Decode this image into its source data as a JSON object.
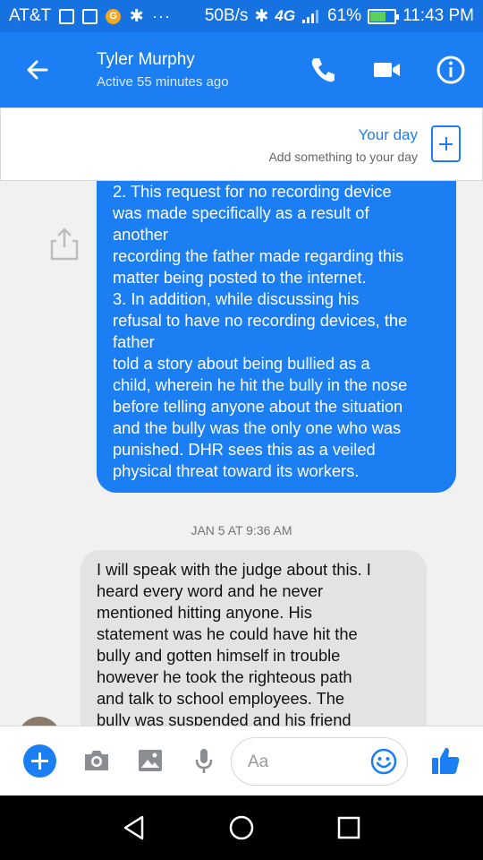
{
  "statusbar": {
    "carrier": "AT&T",
    "overflow": "···",
    "speed": "50B/s",
    "network": "4G",
    "battery": "61%",
    "time": "11:43 PM",
    "battery_level": 0.61
  },
  "header": {
    "name": "Tyler Murphy",
    "status": "Active 55 minutes ago",
    "icons": [
      "back-arrow-icon",
      "phone-icon",
      "video-camera-icon",
      "info-icon"
    ]
  },
  "your_day": {
    "title": "Your day",
    "subtitle": "Add something to your day"
  },
  "messages": {
    "outgoing": "2. This request for no recording device\nwas made specifically as a result of\nanother\nrecording the father made regarding this\nmatter being posted to the internet.\n3. In addition, while discussing his\nrefusal to have no recording devices, the\nfather\ntold a story about being bullied as a\nchild, wherein he hit the bully in the nose\nbefore telling anyone about the situation\nand the bully was the only one who was\npunished. DHR sees this as a veiled\nphysical threat toward its workers.",
    "timestamp": "JAN 5 AT 9:36 AM",
    "incoming": "I will speak with the judge about this. I\nheard every word and he never\nmentioned hitting anyone. His\nstatement was he could have hit the\nbully and gotten himself in trouble\nhowever he took the righteous path\nand talk to school employees. The\nbully was suspended and his friend"
  },
  "composer": {
    "placeholder": "Aa",
    "icons": [
      "plus-icon",
      "camera-icon",
      "image-icon",
      "microphone-icon",
      "emoji-icon",
      "thumbs-up-icon"
    ]
  },
  "colors": {
    "accent": "#1b7ef2",
    "statusbar": "#1672e0",
    "incoming_bubble": "#e3e3e3"
  }
}
